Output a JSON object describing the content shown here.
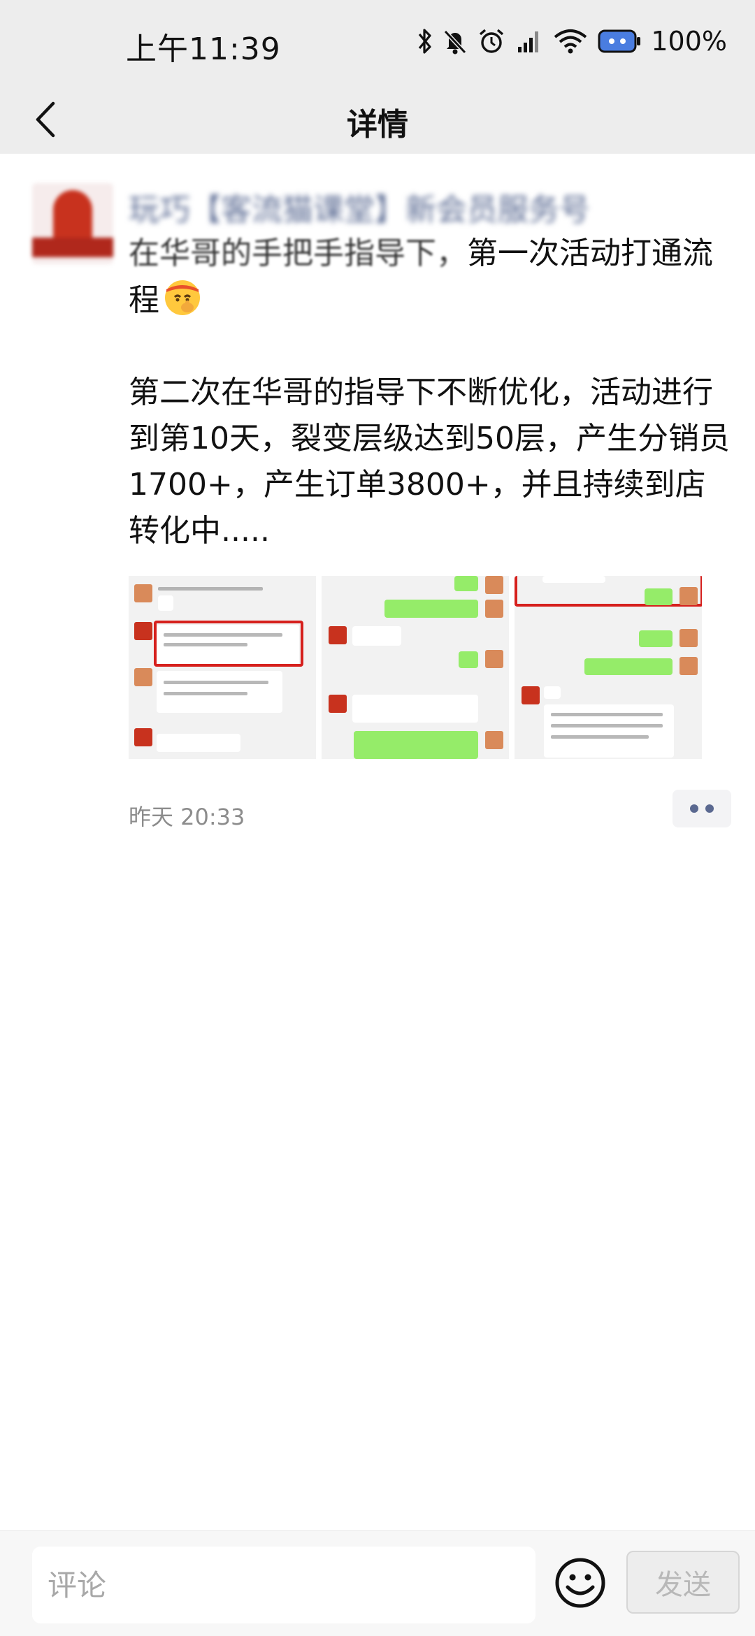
{
  "status_bar": {
    "time": "上午11:39",
    "battery": "100%",
    "icons": [
      "bluetooth-icon",
      "mute-icon",
      "alarm-icon",
      "signal-icon",
      "wifi-icon",
      "battery-icon"
    ]
  },
  "nav": {
    "back_icon": "chevron-left-icon",
    "title": "详情"
  },
  "post": {
    "author_name": "玩巧【客流猫课堂】新会员服务号",
    "para1_lead": "在华哥的手把手指导下，",
    "para1_rest": "第一次活动打通流程",
    "para1_emoji": "shushing-face-emoji",
    "para2": "第二次在华哥的指导下不断优化，活动进行到第10天，裂变层级达到50层，产生分销员1700+，产生订单3800+，并且持续到店转化中.....",
    "images": [
      "chat-screenshot-1",
      "chat-screenshot-2",
      "chat-screenshot-3"
    ],
    "time": "昨天 20:33"
  },
  "comment_bar": {
    "placeholder": "评论",
    "value": "",
    "emoji_icon": "smiley-icon",
    "send_label": "发送"
  },
  "colors": {
    "header_bg": "#ededed",
    "link_blue": "#5b6b93",
    "wechat_green": "#95ec69",
    "highlight_red": "#d6201d"
  }
}
